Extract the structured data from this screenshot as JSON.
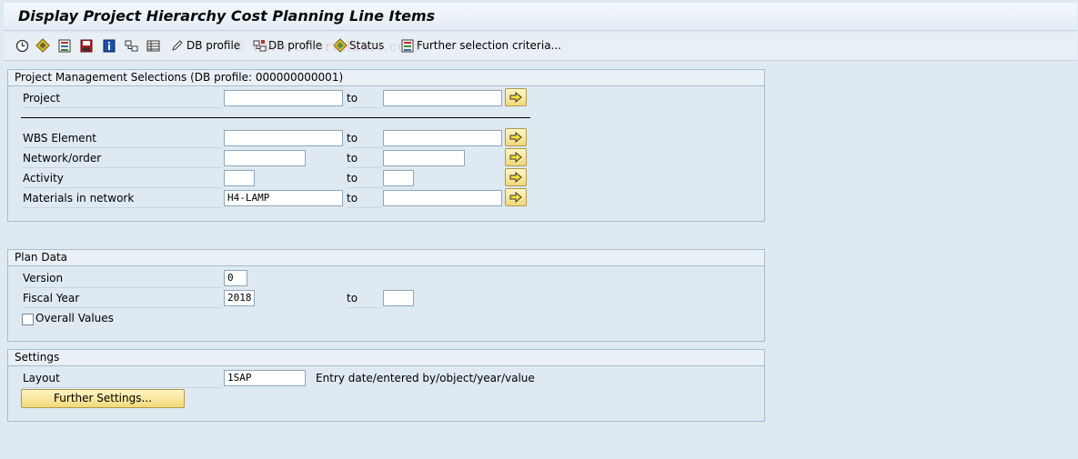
{
  "title": "Display Project Hierarchy Cost Planning Line Items",
  "watermark": "© www.tutorialkart.com",
  "toolbar": {
    "db_profile_1": "DB profile",
    "db_profile_2": "DB profile",
    "status": "Status",
    "further_selection": "Further selection criteria..."
  },
  "pm_selections": {
    "header": "Project Management Selections (DB profile: 000000000001)",
    "to_label": "to",
    "rows": [
      {
        "label": "Project",
        "from": "",
        "to": ""
      },
      {
        "label": "WBS Element",
        "from": "",
        "to": ""
      },
      {
        "label": "Network/order",
        "from": "",
        "to": ""
      },
      {
        "label": "Activity",
        "from": "",
        "to": ""
      },
      {
        "label": "Materials in network",
        "from": "H4-LAMP",
        "to": ""
      }
    ]
  },
  "plan_data": {
    "header": "Plan Data",
    "version_label": "Version",
    "version_value": "0",
    "fiscal_year_label": "Fiscal Year",
    "fiscal_year_from": "2018",
    "fiscal_year_to": "",
    "to_label": "to",
    "overall_values_label": "Overall Values",
    "overall_values_checked": false
  },
  "settings": {
    "header": "Settings",
    "layout_label": "Layout",
    "layout_value": "1SAP",
    "layout_description": "Entry date/entered by/object/year/value",
    "further_settings_button": "Further Settings..."
  },
  "colors": {
    "background": "#dfe9f2",
    "button_yellow": "#f3d97a",
    "group_border": "#a7bccd"
  }
}
